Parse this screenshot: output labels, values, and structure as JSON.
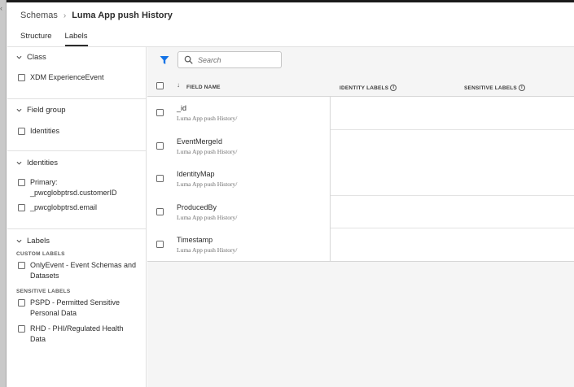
{
  "breadcrumb": {
    "parent": "Schemas",
    "separator": "›",
    "current": "Luma App push History"
  },
  "tabs": [
    {
      "label": "Structure",
      "active": false
    },
    {
      "label": "Labels",
      "active": true
    }
  ],
  "sidebar": {
    "class": {
      "title": "Class",
      "items": [
        {
          "label": "XDM ExperienceEvent"
        }
      ]
    },
    "field_group": {
      "title": "Field group",
      "items": [
        {
          "label": "Identities"
        }
      ]
    },
    "identities": {
      "title": "Identities",
      "items": [
        {
          "line1": "Primary:",
          "line2": "_pwcglobptrsd.customerID"
        },
        {
          "line1": "_pwcglobptrsd.email"
        }
      ]
    },
    "labels": {
      "title": "Labels",
      "custom_heading": "CUSTOM LABELS",
      "custom_items": [
        {
          "line1": "OnlyEvent - Event Schemas and",
          "line2": "Datasets"
        }
      ],
      "sensitive_heading": "SENSITIVE LABELS",
      "sensitive_items": [
        {
          "line1": "PSPD - Permitted Sensitive",
          "line2": "Personal Data"
        },
        {
          "line1": "RHD - PHI/Regulated Health",
          "line2": "Data"
        }
      ]
    }
  },
  "toolbar": {
    "search_placeholder": "Search",
    "filter_icon": "filter-icon",
    "search_icon": "search-icon"
  },
  "table": {
    "columns": {
      "field_name": "FIELD NAME",
      "identity_labels": "IDENTITY LABELS",
      "sensitive_labels": "SENSITIVE LABELS"
    },
    "rows": [
      {
        "name": "_id",
        "path": "Luma App push History/"
      },
      {
        "name": "EventMergeId",
        "path": "Luma App push History/"
      },
      {
        "name": "IdentityMap",
        "path": "Luma App push History/"
      },
      {
        "name": "ProducedBy",
        "path": "Luma App push History/"
      },
      {
        "name": "Timestamp",
        "path": "Luma App push History/"
      }
    ]
  },
  "colors": {
    "accent_blue": "#1473e6",
    "text": "#2c2c2c",
    "panel_bg": "#f5f5f5"
  }
}
